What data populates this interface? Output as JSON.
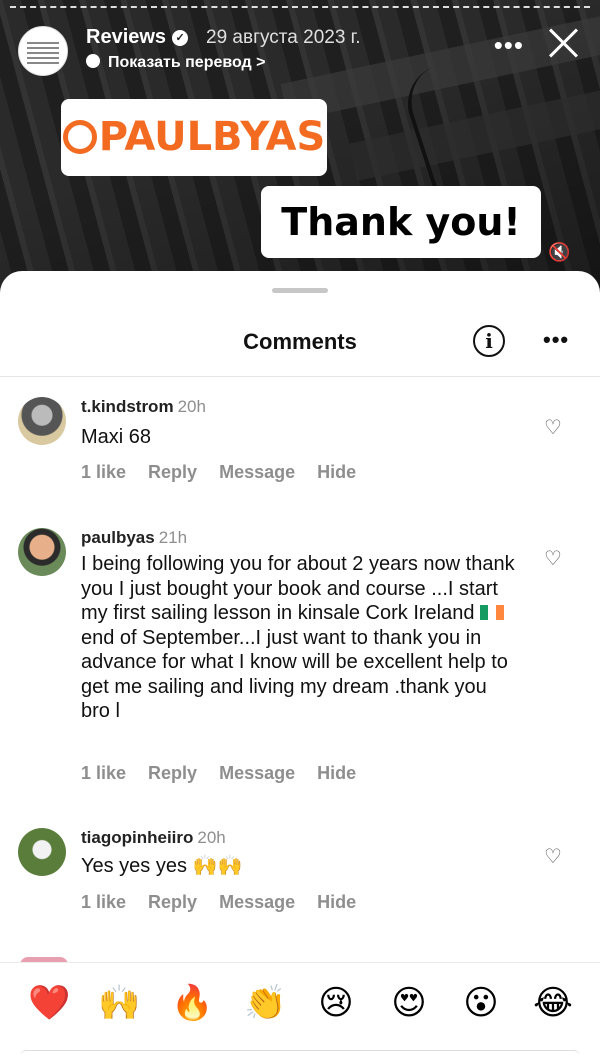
{
  "story": {
    "account": "Reviews",
    "date": "29 августа 2023 г.",
    "translate_label": "Показать перевод",
    "translate_chevron": ">",
    "more_label": "•••",
    "sticker_handle": "PAULBYAS",
    "sticker_thanks": "Thank you!",
    "icons": [
      "verified-icon",
      "speech-bubble-icon",
      "more-icon",
      "close-icon",
      "threads-logo",
      "mute-icon"
    ]
  },
  "comments_sheet": {
    "title": "Comments",
    "info_label": "i",
    "more_label": "•••",
    "comments": [
      {
        "username": "t.kindstrom",
        "time": "20h",
        "text": "Maxi 68",
        "like_count": "1 like",
        "reply": "Reply",
        "message": "Message",
        "hide": "Hide"
      },
      {
        "username": "paulbyas",
        "time": "21h",
        "text_part1": "I being following you for about 2 years now thank you I just bought your book and course ...I start my first sailing lesson in kinsale Cork Ireland",
        "text_part2": "end of September...I just want to thank you in advance for what I know will be excellent help to get me sailing and living my dream .thank you bro l",
        "like_count": "1 like",
        "reply": "Reply",
        "message": "Message",
        "hide": "Hide"
      },
      {
        "username": "tiagopinheiiro",
        "time": "20h",
        "text": "Yes yes yes 🙌🙌",
        "like_count": "1 like",
        "reply": "Reply",
        "message": "Message",
        "hide": "Hide"
      }
    ]
  },
  "reactions": [
    "❤️",
    "🙌",
    "🔥",
    "👏",
    "😢",
    "😍",
    "😮",
    "😂"
  ],
  "colors": {
    "handle_orange": "#f26b21",
    "muted_gray": "#8e8e8e",
    "heart_red": "#e0243b"
  }
}
